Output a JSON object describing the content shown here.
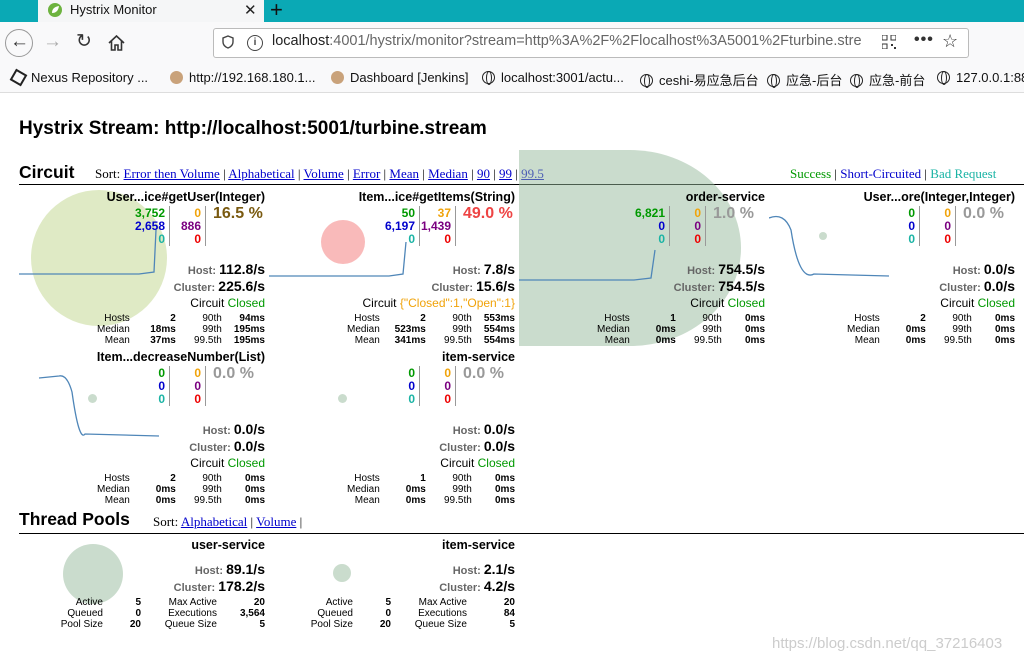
{
  "browser": {
    "tab_title": "Hystrix Monitor",
    "url_host": "localhost",
    "url_rest": ":4001/hystrix/monitor?stream=http%3A%2F%2Flocalhost%3A5001%2Fturbine.stre",
    "bookmarks": [
      "Nexus Repository ...",
      "http://192.168.180.1...",
      "Dashboard [Jenkins]",
      "localhost:3001/actu...",
      "ceshi-易应急后台",
      "应急-后台",
      "应急-前台",
      "127.0.0.1:88"
    ]
  },
  "page": {
    "title": "Hystrix Stream: http://localhost:5001/turbine.stream"
  },
  "circuit": {
    "heading": "Circuit",
    "sort_label": "Sort:",
    "sort_options": [
      "Error then Volume",
      "Alphabetical",
      "Volume",
      "Error",
      "Mean",
      "Median",
      "90",
      "99",
      "99.5"
    ],
    "legend": {
      "success": "Success",
      "short": "Short-Circuited",
      "bad": "Bad Request"
    },
    "cards": [
      {
        "name": "User...ice#getUser(Integer)",
        "n1": "3,752",
        "n2": "2,658",
        "n3": "0",
        "n4": "0",
        "n5": "886",
        "n6": "0",
        "pct": "16.5 %",
        "host": "112.8/s",
        "cluster": "225.6/s",
        "circuit_label": "Circuit",
        "circuit_state": "Closed",
        "hosts": "2",
        "median": "18ms",
        "mean": "37ms",
        "p90": "94ms",
        "p99": "195ms",
        "p995": "195ms"
      },
      {
        "name": "Item...ice#getItems(String)",
        "n1": "50",
        "n2": "6,197",
        "n3": "0",
        "n4": "37",
        "n5": "1,439",
        "n6": "0",
        "pct": "49.0 %",
        "host": "7.8/s",
        "cluster": "15.6/s",
        "circuit_label": "Circuit",
        "circuit_state": "{\"Closed\":1,\"Open\":1}",
        "hosts": "2",
        "median": "523ms",
        "mean": "341ms",
        "p90": "553ms",
        "p99": "554ms",
        "p995": "554ms"
      },
      {
        "name": "order-service",
        "n1": "6,821",
        "n2": "0",
        "n3": "0",
        "n4": "0",
        "n5": "0",
        "n6": "0",
        "pct": "1.0 %",
        "host": "754.5/s",
        "cluster": "754.5/s",
        "circuit_label": "Circuit",
        "circuit_state": "Closed",
        "hosts": "1",
        "median": "0ms",
        "mean": "0ms",
        "p90": "0ms",
        "p99": "0ms",
        "p995": "0ms"
      },
      {
        "name": "User...ore(Integer,Integer)",
        "n1": "0",
        "n2": "0",
        "n3": "0",
        "n4": "0",
        "n5": "0",
        "n6": "0",
        "pct": "0.0 %",
        "host": "0.0/s",
        "cluster": "0.0/s",
        "circuit_label": "Circuit",
        "circuit_state": "Closed",
        "hosts": "2",
        "median": "0ms",
        "mean": "0ms",
        "p90": "0ms",
        "p99": "0ms",
        "p995": "0ms"
      },
      {
        "name": "Item...decreaseNumber(List)",
        "n1": "0",
        "n2": "0",
        "n3": "0",
        "n4": "0",
        "n5": "0",
        "n6": "0",
        "pct": "0.0 %",
        "host": "0.0/s",
        "cluster": "0.0/s",
        "circuit_label": "Circuit",
        "circuit_state": "Closed",
        "hosts": "2",
        "median": "0ms",
        "mean": "0ms",
        "p90": "0ms",
        "p99": "0ms",
        "p995": "0ms"
      },
      {
        "name": "item-service",
        "n1": "0",
        "n2": "0",
        "n3": "0",
        "n4": "0",
        "n5": "0",
        "n6": "0",
        "pct": "0.0 %",
        "host": "0.0/s",
        "cluster": "0.0/s",
        "circuit_label": "Circuit",
        "circuit_state": "Closed",
        "hosts": "1",
        "median": "0ms",
        "mean": "0ms",
        "p90": "0ms",
        "p99": "0ms",
        "p995": "0ms"
      }
    ],
    "stat_labels": {
      "hosts": "Hosts",
      "median": "Median",
      "mean": "Mean",
      "p90": "90th",
      "p99": "99th",
      "p995": "99.5th",
      "host": "Host:",
      "cluster": "Cluster:"
    }
  },
  "threadpools": {
    "heading": "Thread Pools",
    "sort_label": "Sort:",
    "sort_options": [
      "Alphabetical",
      "Volume"
    ],
    "labels": {
      "active": "Active",
      "queued": "Queued",
      "poolsize": "Pool Size",
      "maxactive": "Max Active",
      "executions": "Executions",
      "queuesize": "Queue Size",
      "host": "Host:",
      "cluster": "Cluster:"
    },
    "pools": [
      {
        "name": "user-service",
        "host": "89.1/s",
        "cluster": "178.2/s",
        "active": "5",
        "queued": "0",
        "poolsize": "20",
        "maxactive": "20",
        "executions": "3,564",
        "queuesize": "5"
      },
      {
        "name": "item-service",
        "host": "2.1/s",
        "cluster": "4.2/s",
        "active": "5",
        "queued": "0",
        "poolsize": "20",
        "maxactive": "20",
        "executions": "84",
        "queuesize": "5"
      }
    ]
  },
  "watermark": "https://blog.csdn.net/qq_37216403"
}
